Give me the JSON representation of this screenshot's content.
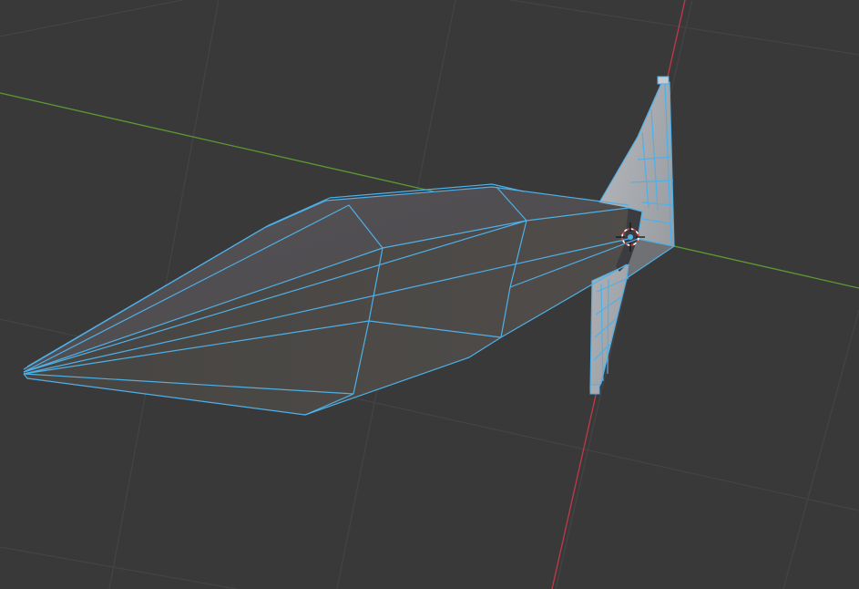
{
  "viewport": {
    "type": "3d-viewport",
    "mode": "edit-mode",
    "background_color": "#393939",
    "grid_color": "#4a4a4a",
    "x_axis_color": "#c2384a",
    "y_axis_color": "#5c9a32",
    "selection_color": "#4fb0e8",
    "object": {
      "name_visible": false,
      "selected": true,
      "shape": "arrowhead-like mesh (elongated diamond blade with wing fin)"
    },
    "cursor_3d": {
      "visible": true,
      "icon": "3d-cursor-icon"
    }
  }
}
